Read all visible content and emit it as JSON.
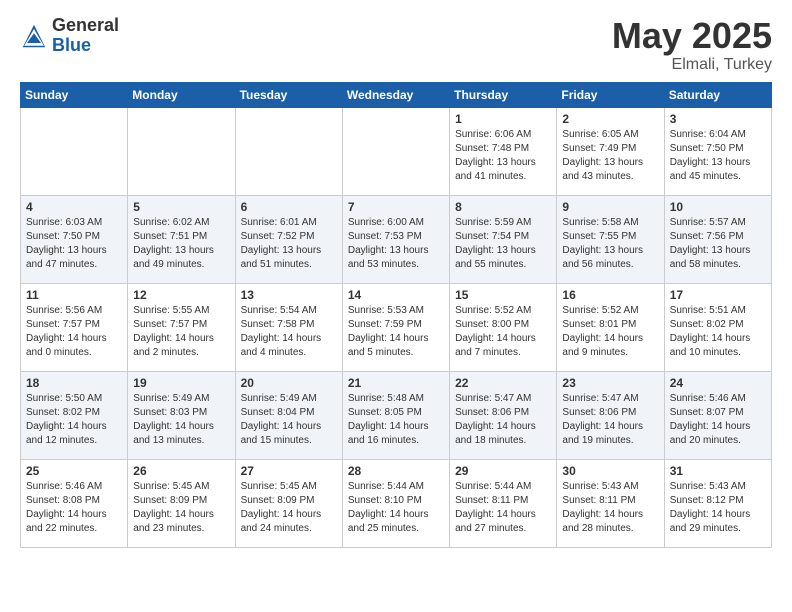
{
  "header": {
    "logo_general": "General",
    "logo_blue": "Blue",
    "title": "May 2025",
    "location": "Elmali, Turkey"
  },
  "weekdays": [
    "Sunday",
    "Monday",
    "Tuesday",
    "Wednesday",
    "Thursday",
    "Friday",
    "Saturday"
  ],
  "weeks": [
    [
      {
        "day": "",
        "info": ""
      },
      {
        "day": "",
        "info": ""
      },
      {
        "day": "",
        "info": ""
      },
      {
        "day": "",
        "info": ""
      },
      {
        "day": "1",
        "info": "Sunrise: 6:06 AM\nSunset: 7:48 PM\nDaylight: 13 hours\nand 41 minutes."
      },
      {
        "day": "2",
        "info": "Sunrise: 6:05 AM\nSunset: 7:49 PM\nDaylight: 13 hours\nand 43 minutes."
      },
      {
        "day": "3",
        "info": "Sunrise: 6:04 AM\nSunset: 7:50 PM\nDaylight: 13 hours\nand 45 minutes."
      }
    ],
    [
      {
        "day": "4",
        "info": "Sunrise: 6:03 AM\nSunset: 7:50 PM\nDaylight: 13 hours\nand 47 minutes."
      },
      {
        "day": "5",
        "info": "Sunrise: 6:02 AM\nSunset: 7:51 PM\nDaylight: 13 hours\nand 49 minutes."
      },
      {
        "day": "6",
        "info": "Sunrise: 6:01 AM\nSunset: 7:52 PM\nDaylight: 13 hours\nand 51 minutes."
      },
      {
        "day": "7",
        "info": "Sunrise: 6:00 AM\nSunset: 7:53 PM\nDaylight: 13 hours\nand 53 minutes."
      },
      {
        "day": "8",
        "info": "Sunrise: 5:59 AM\nSunset: 7:54 PM\nDaylight: 13 hours\nand 55 minutes."
      },
      {
        "day": "9",
        "info": "Sunrise: 5:58 AM\nSunset: 7:55 PM\nDaylight: 13 hours\nand 56 minutes."
      },
      {
        "day": "10",
        "info": "Sunrise: 5:57 AM\nSunset: 7:56 PM\nDaylight: 13 hours\nand 58 minutes."
      }
    ],
    [
      {
        "day": "11",
        "info": "Sunrise: 5:56 AM\nSunset: 7:57 PM\nDaylight: 14 hours\nand 0 minutes."
      },
      {
        "day": "12",
        "info": "Sunrise: 5:55 AM\nSunset: 7:57 PM\nDaylight: 14 hours\nand 2 minutes."
      },
      {
        "day": "13",
        "info": "Sunrise: 5:54 AM\nSunset: 7:58 PM\nDaylight: 14 hours\nand 4 minutes."
      },
      {
        "day": "14",
        "info": "Sunrise: 5:53 AM\nSunset: 7:59 PM\nDaylight: 14 hours\nand 5 minutes."
      },
      {
        "day": "15",
        "info": "Sunrise: 5:52 AM\nSunset: 8:00 PM\nDaylight: 14 hours\nand 7 minutes."
      },
      {
        "day": "16",
        "info": "Sunrise: 5:52 AM\nSunset: 8:01 PM\nDaylight: 14 hours\nand 9 minutes."
      },
      {
        "day": "17",
        "info": "Sunrise: 5:51 AM\nSunset: 8:02 PM\nDaylight: 14 hours\nand 10 minutes."
      }
    ],
    [
      {
        "day": "18",
        "info": "Sunrise: 5:50 AM\nSunset: 8:02 PM\nDaylight: 14 hours\nand 12 minutes."
      },
      {
        "day": "19",
        "info": "Sunrise: 5:49 AM\nSunset: 8:03 PM\nDaylight: 14 hours\nand 13 minutes."
      },
      {
        "day": "20",
        "info": "Sunrise: 5:49 AM\nSunset: 8:04 PM\nDaylight: 14 hours\nand 15 minutes."
      },
      {
        "day": "21",
        "info": "Sunrise: 5:48 AM\nSunset: 8:05 PM\nDaylight: 14 hours\nand 16 minutes."
      },
      {
        "day": "22",
        "info": "Sunrise: 5:47 AM\nSunset: 8:06 PM\nDaylight: 14 hours\nand 18 minutes."
      },
      {
        "day": "23",
        "info": "Sunrise: 5:47 AM\nSunset: 8:06 PM\nDaylight: 14 hours\nand 19 minutes."
      },
      {
        "day": "24",
        "info": "Sunrise: 5:46 AM\nSunset: 8:07 PM\nDaylight: 14 hours\nand 20 minutes."
      }
    ],
    [
      {
        "day": "25",
        "info": "Sunrise: 5:46 AM\nSunset: 8:08 PM\nDaylight: 14 hours\nand 22 minutes."
      },
      {
        "day": "26",
        "info": "Sunrise: 5:45 AM\nSunset: 8:09 PM\nDaylight: 14 hours\nand 23 minutes."
      },
      {
        "day": "27",
        "info": "Sunrise: 5:45 AM\nSunset: 8:09 PM\nDaylight: 14 hours\nand 24 minutes."
      },
      {
        "day": "28",
        "info": "Sunrise: 5:44 AM\nSunset: 8:10 PM\nDaylight: 14 hours\nand 25 minutes."
      },
      {
        "day": "29",
        "info": "Sunrise: 5:44 AM\nSunset: 8:11 PM\nDaylight: 14 hours\nand 27 minutes."
      },
      {
        "day": "30",
        "info": "Sunrise: 5:43 AM\nSunset: 8:11 PM\nDaylight: 14 hours\nand 28 minutes."
      },
      {
        "day": "31",
        "info": "Sunrise: 5:43 AM\nSunset: 8:12 PM\nDaylight: 14 hours\nand 29 minutes."
      }
    ]
  ]
}
